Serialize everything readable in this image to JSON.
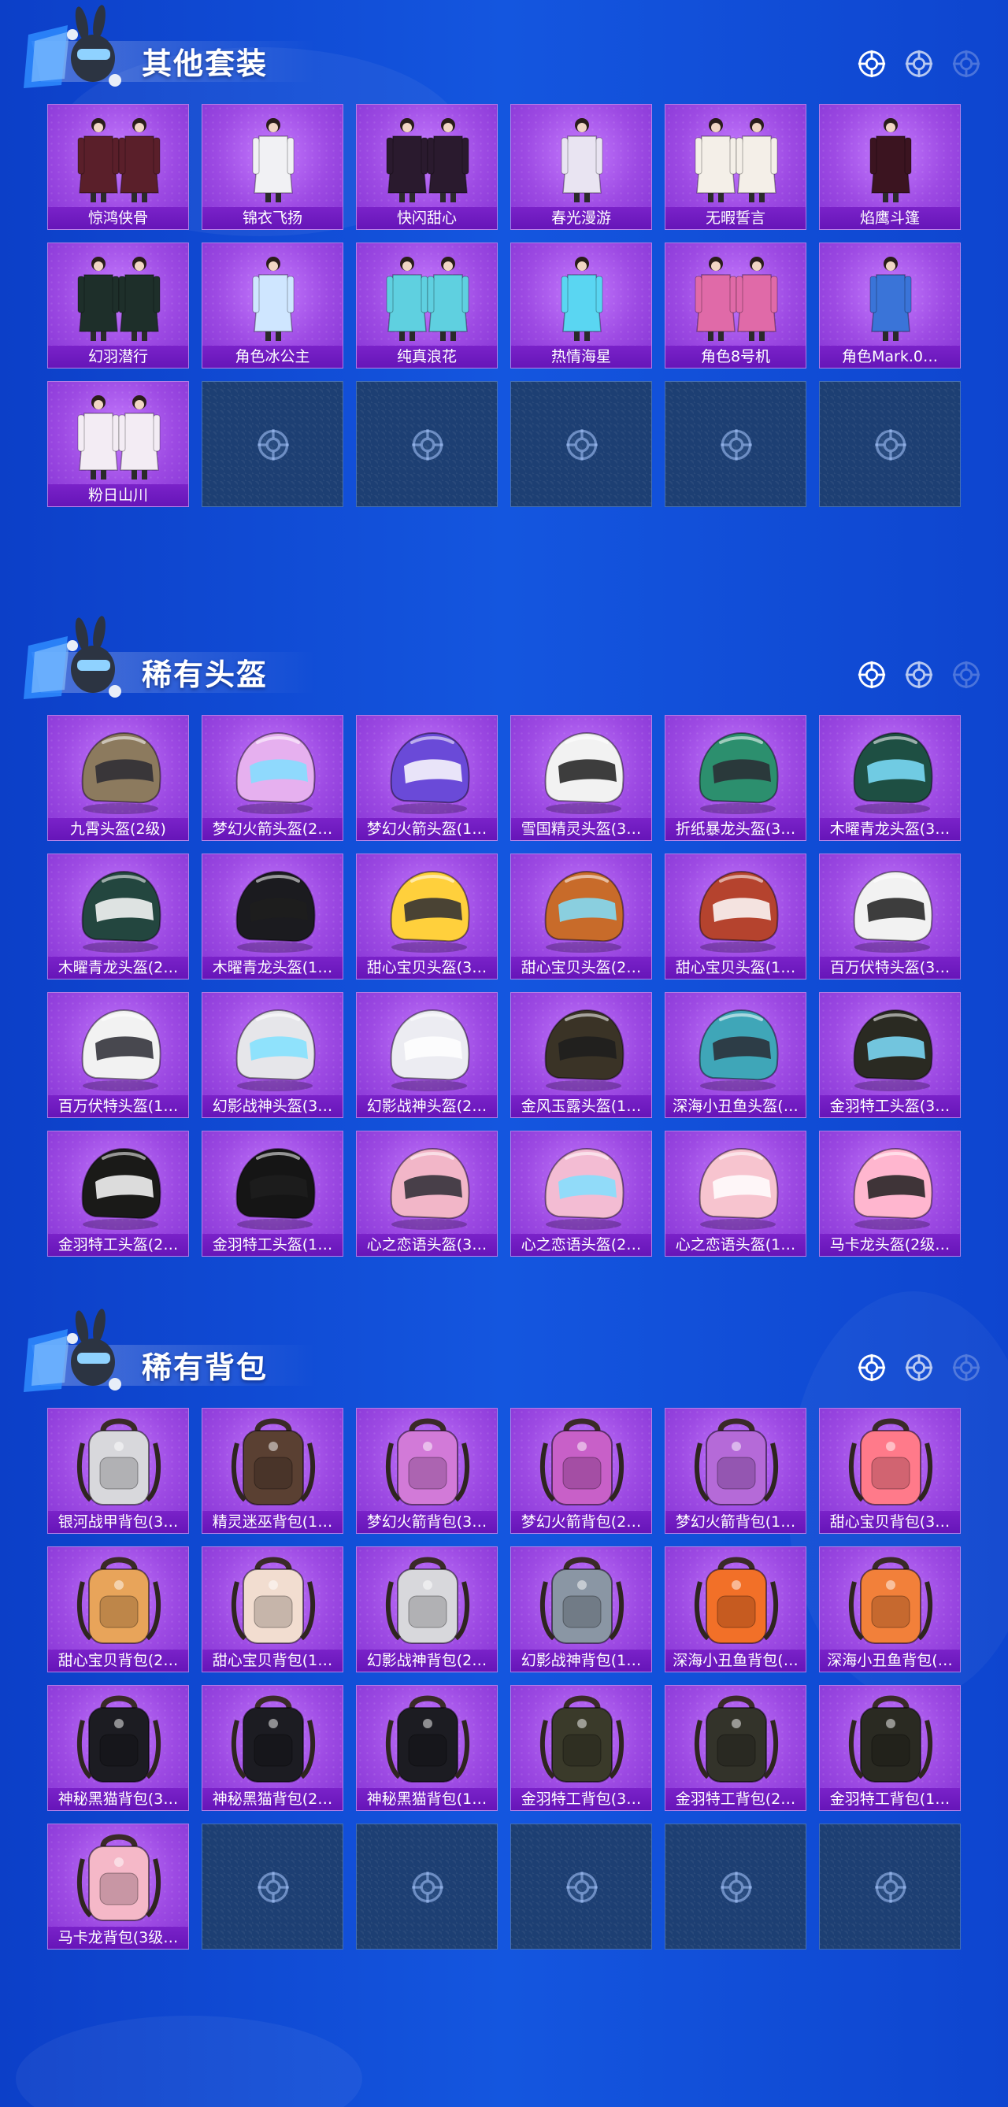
{
  "sections": [
    {
      "title": "其他套装",
      "kind": "outfit",
      "items": [
        "惊鸿侠骨",
        "锦衣飞扬",
        "快闪甜心",
        "春光漫游",
        "无暇誓言",
        "焰鹰斗篷",
        "幻羽潜行",
        "角色冰公主",
        "纯真浪花",
        "热情海星",
        "角色8号机",
        "角色Mark.0…",
        "粉日山川"
      ],
      "empty_slots": 5
    },
    {
      "title": "稀有头盔",
      "kind": "helmet",
      "items": [
        "九霄头盔(2级)",
        "梦幻火箭头盔(2…",
        "梦幻火箭头盔(1…",
        "雪国精灵头盔(3…",
        "折纸暴龙头盔(3…",
        "木曜青龙头盔(3…",
        "木曜青龙头盔(2…",
        "木曜青龙头盔(1…",
        "甜心宝贝头盔(3…",
        "甜心宝贝头盔(2…",
        "甜心宝贝头盔(1…",
        "百万伏特头盔(3…",
        "百万伏特头盔(1…",
        "幻影战神头盔(3…",
        "幻影战神头盔(2…",
        "金风玉露头盔(1…",
        "深海小丑鱼头盔(…",
        "金羽特工头盔(3…",
        "金羽特工头盔(2…",
        "金羽特工头盔(1…",
        "心之恋语头盔(3…",
        "心之恋语头盔(2…",
        "心之恋语头盔(1…",
        "马卡龙头盔(2级…"
      ],
      "empty_slots": 0
    },
    {
      "title": "稀有背包",
      "kind": "backpack",
      "items": [
        "银河战甲背包(3…",
        "精灵迷巫背包(1…",
        "梦幻火箭背包(3…",
        "梦幻火箭背包(2…",
        "梦幻火箭背包(1…",
        "甜心宝贝背包(3…",
        "甜心宝贝背包(2…",
        "甜心宝贝背包(1…",
        "幻影战神背包(2…",
        "幻影战神背包(1…",
        "深海小丑鱼背包(…",
        "深海小丑鱼背包(…",
        "神秘黑猫背包(3…",
        "神秘黑猫背包(2…",
        "神秘黑猫背包(1…",
        "金羽特工背包(3…",
        "金羽特工背包(2…",
        "金羽特工背包(1…",
        "马卡龙背包(3级…"
      ],
      "empty_slots": 5
    }
  ],
  "item_colors": {
    "outfit": [
      "#5a1f2a",
      "#f1f1f4",
      "#2a1a2e",
      "#e9e4f2",
      "#f4efe8",
      "#3b1420",
      "#1e2f2a",
      "#cfe6ff",
      "#5fd0e0",
      "#5ad6f2",
      "#e06aa8",
      "#3a74d8",
      "#f3ecf4"
    ],
    "helmet": [
      "#8c7a5e",
      "#e6b0ef",
      "#6a4ad8",
      "#f2f2f2",
      "#2c8f6e",
      "#1e4f43",
      "#23463f",
      "#1b1b1f",
      "#ffd03c",
      "#c86b2a",
      "#b5432e",
      "#f2f2f2",
      "#f2f2f2",
      "#e6e6ea",
      "#ececf2",
      "#3a3326",
      "#3fa6b8",
      "#2a2a22",
      "#1a1a18",
      "#151515",
      "#f2b6c8",
      "#f3bcd3",
      "#f7c4cf",
      "#ffb6cf"
    ],
    "backpack": [
      "#d8d8dc",
      "#5a4032",
      "#d27ad8",
      "#c860c8",
      "#b56ad8",
      "#ff7a8a",
      "#e8a45a",
      "#f2ddd0",
      "#d8d8dc",
      "#8a96a4",
      "#f27028",
      "#f2803a",
      "#1c1c22",
      "#1c1c22",
      "#1c1c22",
      "#3a3a2a",
      "#33332a",
      "#2a2a22",
      "#f5b8c8"
    ]
  },
  "accent": {
    "card": "#9d4ae3",
    "label_bar": "#6e1ac0",
    "empty": "#1d3f73"
  },
  "icons": {
    "header_target": "crosshair-icon",
    "empty_slot": "crosshair-icon",
    "mascot": "rabbit-mascot-icon"
  }
}
